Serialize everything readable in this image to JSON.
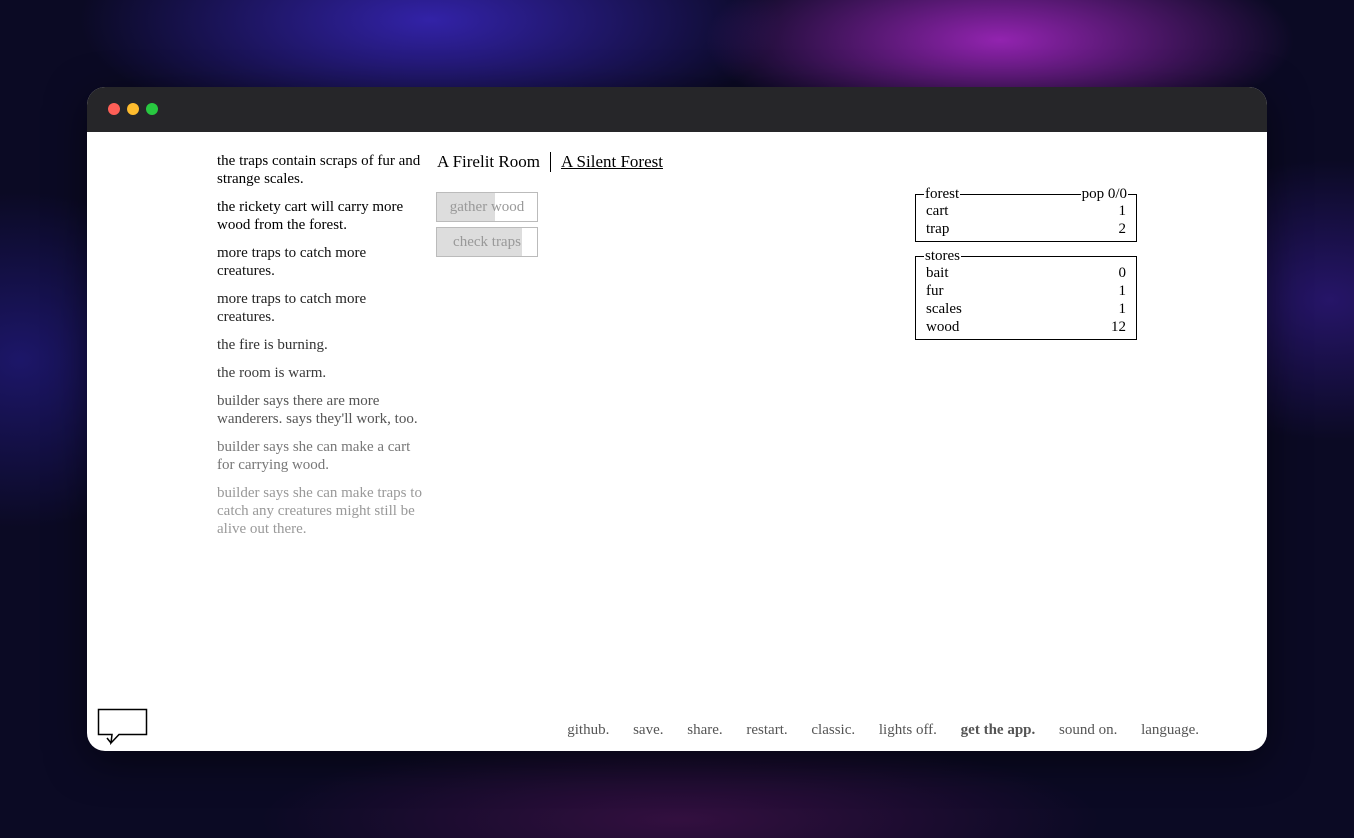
{
  "notifications": [
    {
      "text": "the traps contain scraps of fur and strange scales.",
      "color": "#000000"
    },
    {
      "text": "the rickety cart will carry more wood from the forest.",
      "color": "#000000"
    },
    {
      "text": "more traps to catch more creatures.",
      "color": "#111111"
    },
    {
      "text": "more traps to catch more creatures.",
      "color": "#222222"
    },
    {
      "text": "the fire is burning.",
      "color": "#333333"
    },
    {
      "text": "the room is warm.",
      "color": "#3d3d3d"
    },
    {
      "text": "builder says there are more wanderers. says they'll work, too.",
      "color": "#555555"
    },
    {
      "text": "builder says she can make a cart for carrying wood.",
      "color": "#777777"
    },
    {
      "text": "builder says she can make traps to catch any creatures might still be alive out there.",
      "color": "#999999"
    }
  ],
  "header": {
    "room": "A Firelit Room",
    "forest": "A Silent Forest"
  },
  "buttons": {
    "gather_wood": {
      "label": "gather wood",
      "cooldown_fraction": 0.58
    },
    "check_traps": {
      "label": "check traps",
      "cooldown_fraction": 0.85
    }
  },
  "forest_panel": {
    "title": "forest",
    "population": "pop 0/0",
    "rows": [
      {
        "name": "cart",
        "value": "1"
      },
      {
        "name": "trap",
        "value": "2"
      }
    ]
  },
  "stores_panel": {
    "title": "stores",
    "rows": [
      {
        "name": "bait",
        "value": "0"
      },
      {
        "name": "fur",
        "value": "1"
      },
      {
        "name": "scales",
        "value": "1"
      },
      {
        "name": "wood",
        "value": "12"
      }
    ]
  },
  "footer": {
    "github": "github.",
    "save": "save.",
    "share": "share.",
    "restart": "restart.",
    "classic": "classic.",
    "lights": "lights off.",
    "app": "get the app.",
    "sound": "sound on.",
    "language": "language."
  }
}
